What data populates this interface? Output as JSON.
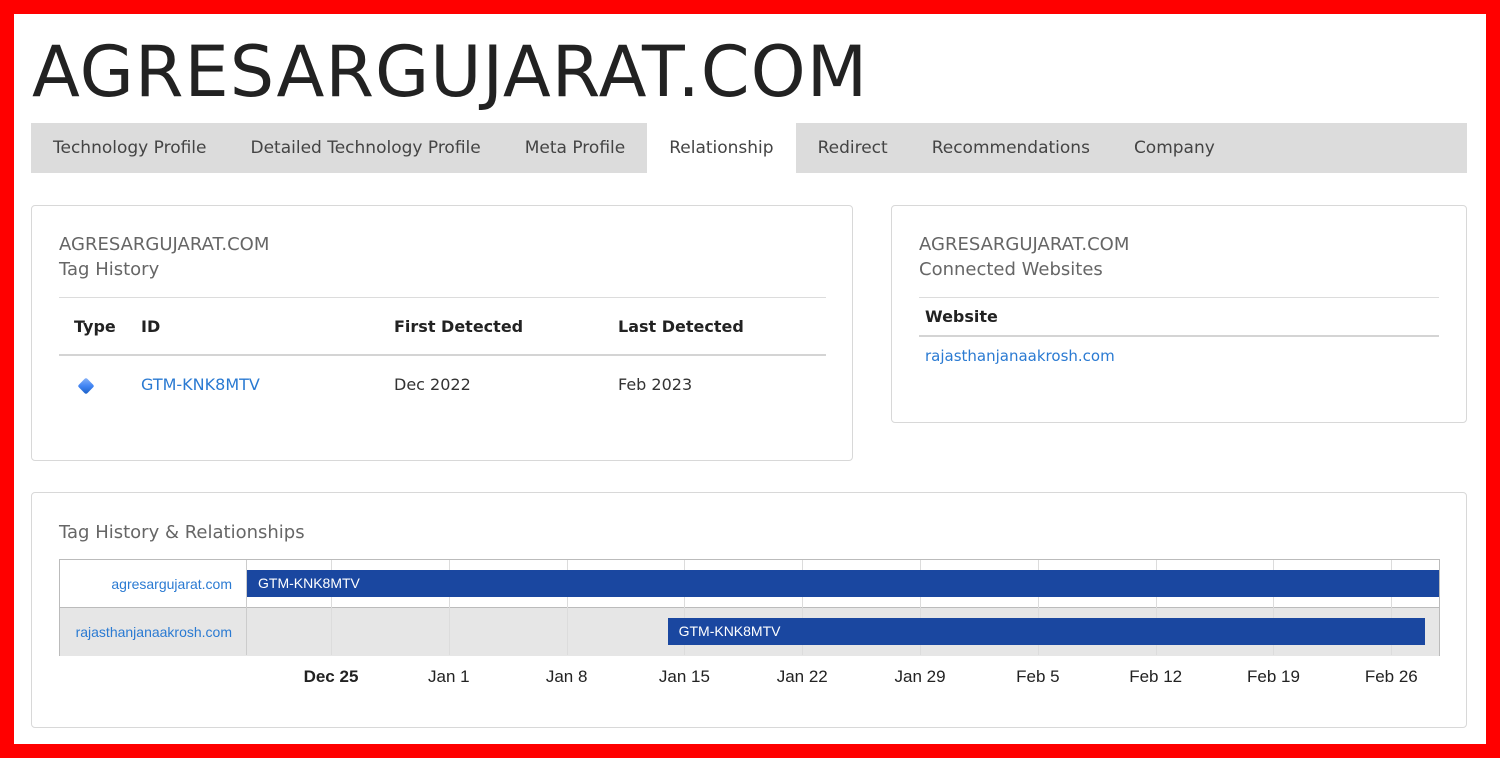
{
  "site": {
    "title": "AGRESARGUJARAT.COM"
  },
  "tabs": [
    {
      "label": "Technology Profile"
    },
    {
      "label": "Detailed Technology Profile"
    },
    {
      "label": "Meta Profile"
    },
    {
      "label": "Relationship",
      "active": true
    },
    {
      "label": "Redirect"
    },
    {
      "label": "Recommendations"
    },
    {
      "label": "Company"
    }
  ],
  "tag_history": {
    "domain": "AGRESARGUJARAT.COM",
    "subtitle": "Tag History",
    "headers": {
      "type": "Type",
      "id": "ID",
      "first": "First Detected",
      "last": "Last Detected"
    },
    "rows": [
      {
        "type_icon": "google-tag-manager-icon",
        "id": "GTM-KNK8MTV",
        "first": "Dec 2022",
        "last": "Feb 2023"
      }
    ]
  },
  "connected": {
    "domain": "AGRESARGUJARAT.COM",
    "subtitle": "Connected Websites",
    "header": "Website",
    "rows": [
      {
        "website": "rajasthanjanaakrosh.com"
      }
    ]
  },
  "timeline": {
    "title": "Tag History & Relationships",
    "rows": [
      {
        "site": "agresargujarat.com",
        "bar": {
          "label": "GTM-KNK8MTV",
          "start": "2022-12-18",
          "end": "2023-03-01"
        }
      },
      {
        "site": "rajasthanjanaakrosh.com",
        "bar": {
          "label": "GTM-KNK8MTV",
          "start": "2023-01-14",
          "end": "2023-02-28"
        }
      }
    ],
    "ticks": [
      {
        "label": "Dec 25",
        "date": "2022-12-25",
        "bold": true
      },
      {
        "label": "Jan 1",
        "date": "2023-01-01"
      },
      {
        "label": "Jan 8",
        "date": "2023-01-08"
      },
      {
        "label": "Jan 15",
        "date": "2023-01-15"
      },
      {
        "label": "Jan 22",
        "date": "2023-01-22"
      },
      {
        "label": "Jan 29",
        "date": "2023-01-29"
      },
      {
        "label": "Feb 5",
        "date": "2023-02-05"
      },
      {
        "label": "Feb 12",
        "date": "2023-02-12"
      },
      {
        "label": "Feb 19",
        "date": "2023-02-19"
      },
      {
        "label": "Feb 26",
        "date": "2023-02-26"
      }
    ],
    "bar_color": "#1a47a0"
  }
}
